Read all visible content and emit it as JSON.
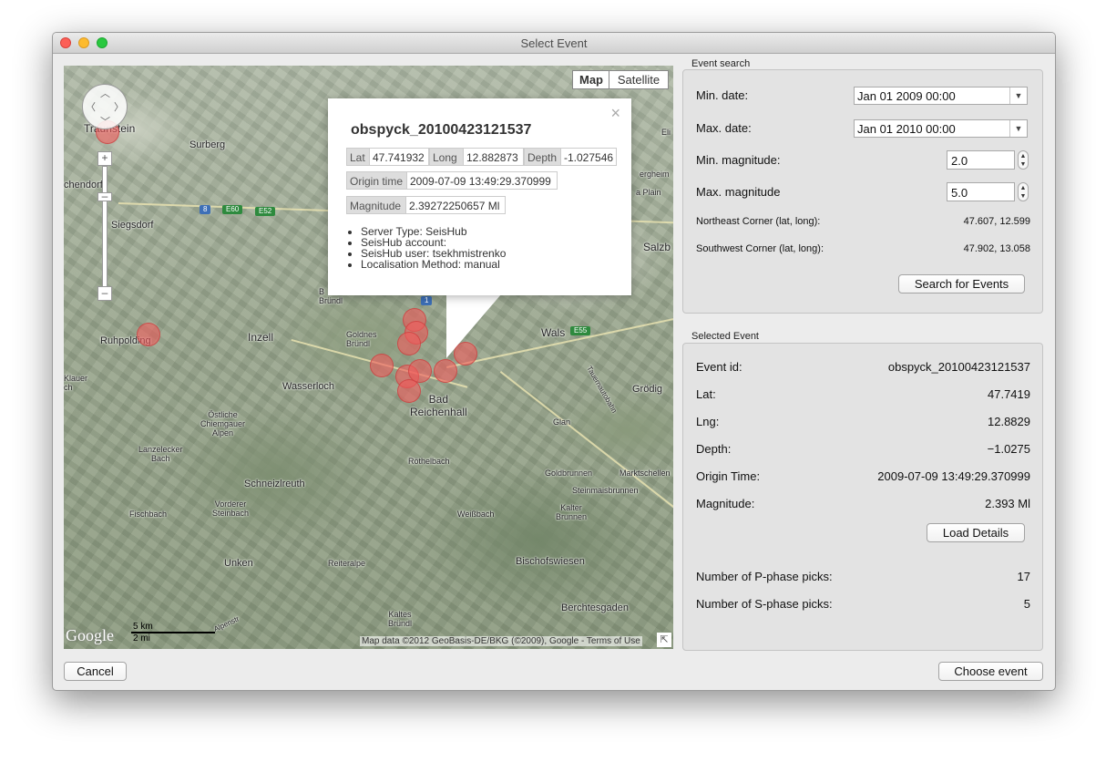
{
  "window": {
    "title": "Select Event"
  },
  "map": {
    "type_map": "Map",
    "type_satellite": "Satellite",
    "labels": {
      "traunstein": "Traunstein",
      "surberg": "Surberg",
      "chendorf": "chendorf",
      "siegsdorf": "Siegsdorf",
      "ruhpolding": "Ruhpolding",
      "inzell": "Inzell",
      "bruendl": "B\nBründl",
      "goldnes": "Goldnes\nBründl",
      "wasserloch": "Wasserloch",
      "klauer": "Klauer\nch",
      "oestliche": "Östliche\nChiemgauer\nAlpen",
      "lanzelecker": "Lanzelecker\nBach",
      "bad_reichenhall": "Bad\nReichenhall",
      "schneizlreuth": "Schneizlreuth",
      "vorderer": "Vorderer\nSteinbach",
      "fischbach": "Fischbach",
      "roethelbach": "Röthelbach",
      "weissbach": "Weißbach",
      "unken": "Unken",
      "reiteralpe": "Reiteralpe",
      "bischofswiesen": "Bischofswiesen",
      "berchtesgaden": "Berchtesgaden",
      "kaltes": "Kaltes\nBründl",
      "wals": "Wals",
      "salzb": "Salzb",
      "groedig": "Grödig",
      "glan": "Glan",
      "goldbrunnen": "Goldbrunnen",
      "marktschellen": "Marktschellen",
      "steinmaisbrunnen": "Steinmaisbrunnen",
      "kalter": "Kalter\nBrunnen",
      "eli": "Eli",
      "bergheim": "ergheim",
      "plain": "a Plain",
      "tauern": "Tauernautobahn",
      "alpenstr": "Alpenstr"
    },
    "shields": {
      "s8": "8",
      "e60": "E60",
      "e52": "E52",
      "e55": "E55",
      "s1": "1"
    },
    "scale_km": "5 km",
    "scale_mi": "2 mi",
    "logo": "Google",
    "copyright": "Map data ©2012 GeoBasis-DE/BKG (©2009), Google - Terms of Use"
  },
  "popup": {
    "title": "obspyck_20100423121537",
    "lat_label": "Lat",
    "lat_value": "47.741932",
    "long_label": "Long",
    "long_value": "12.882873",
    "depth_label": "Depth",
    "depth_value": "-1.027546",
    "origin_label": "Origin time",
    "origin_value": "2009-07-09 13:49:29.370999",
    "magnitude_label": "Magnitude",
    "magnitude_value": "2.39272250657 Ml",
    "items": [
      "Server Type: SeisHub",
      "SeisHub account:",
      "SeisHub user: tsekhmistrenko",
      "Localisation Method: manual"
    ]
  },
  "search": {
    "group_title": "Event search",
    "min_date_label": "Min. date:",
    "min_date_value": "Jan 01 2009 00:00",
    "max_date_label": "Max. date:",
    "max_date_value": "Jan 01 2010 00:00",
    "min_mag_label": "Min. magnitude:",
    "min_mag_value": "2.0",
    "max_mag_label": "Max. magnitude",
    "max_mag_value": "5.0",
    "ne_label": "Northeast Corner (lat, long):",
    "ne_value": "47.607, 12.599",
    "sw_label": "Southwest Corner (lat, long):",
    "sw_value": "47.902, 13.058",
    "search_button": "Search for Events"
  },
  "selected": {
    "group_title": "Selected Event",
    "rows": [
      {
        "label": "Event id:",
        "value": "obspyck_20100423121537"
      },
      {
        "label": "Lat:",
        "value": "47.7419"
      },
      {
        "label": "Lng:",
        "value": "12.8829"
      },
      {
        "label": "Depth:",
        "value": "−1.0275"
      },
      {
        "label": "Origin Time:",
        "value": "2009-07-09 13:49:29.370999"
      },
      {
        "label": "Magnitude:",
        "value": "2.393 Ml"
      }
    ],
    "load_button": "Load Details",
    "p_label": "Number of P-phase picks:",
    "p_value": "17",
    "s_label": "Number of S-phase picks:",
    "s_value": "5"
  },
  "footer": {
    "cancel": "Cancel",
    "choose": "Choose event"
  }
}
